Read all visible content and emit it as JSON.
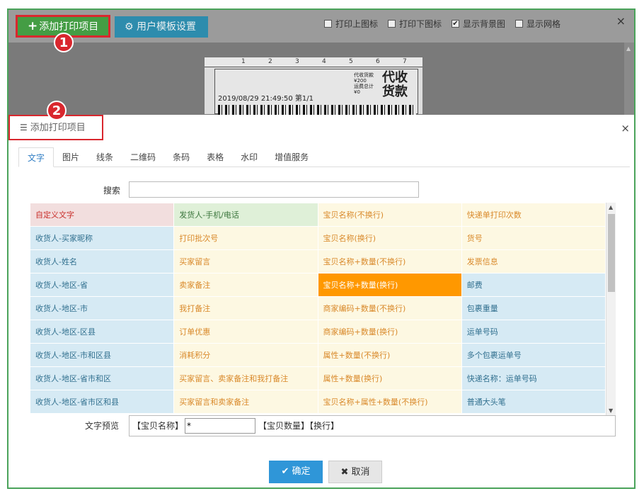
{
  "toolbar": {
    "add_button_label": "添加打印项目",
    "template_button_label": "用户模板设置",
    "checkboxes": [
      {
        "label": "打印上图标",
        "checked": false
      },
      {
        "label": "打印下图标",
        "checked": false
      },
      {
        "label": "显示背景图",
        "checked": true
      },
      {
        "label": "显示网格",
        "checked": false
      }
    ],
    "close_symbol": "×"
  },
  "label_preview": {
    "ruler_numbers": [
      "1",
      "2",
      "3",
      "4",
      "5",
      "6",
      "7"
    ],
    "datetime": "2019/08/29 21:49:50 第1/1",
    "small_lines": [
      "代收货款",
      "¥200",
      "运费总计",
      "¥0"
    ],
    "big_text_line1": "代收",
    "big_text_line2": "货款"
  },
  "badges": {
    "first": "1",
    "second": "2"
  },
  "dialog": {
    "title": "添加打印项目",
    "close_symbol": "×",
    "tabs": [
      {
        "label": "文字",
        "active": true
      },
      {
        "label": "图片",
        "active": false
      },
      {
        "label": "线条",
        "active": false
      },
      {
        "label": "二维码",
        "active": false
      },
      {
        "label": "条码",
        "active": false
      },
      {
        "label": "表格",
        "active": false
      },
      {
        "label": "水印",
        "active": false
      },
      {
        "label": "增值服务",
        "active": false
      }
    ],
    "search_label": "搜索",
    "search_value": "",
    "grid": [
      [
        "自定义文字",
        "发货人-手机/电话",
        "宝贝名称(不换行)",
        "快递单打印次数"
      ],
      [
        "收货人-买家昵称",
        "打印批次号",
        "宝贝名称(换行)",
        "货号"
      ],
      [
        "收货人-姓名",
        "买家留言",
        "宝贝名称+数量(不换行)",
        "发票信息"
      ],
      [
        "收货人-地区-省",
        "卖家备注",
        "宝贝名称+数量(换行)",
        "邮费"
      ],
      [
        "收货人-地区-市",
        "我打备注",
        "商家编码+数量(不换行)",
        "包裹重量"
      ],
      [
        "收货人-地区-区县",
        "订单优惠",
        "商家编码+数量(换行)",
        "运单号码"
      ],
      [
        "收货人-地区-市和区县",
        "消耗积分",
        "属性+数量(不换行)",
        "多个包裹运单号"
      ],
      [
        "收货人-地区-省市和区",
        "买家留言、卖家备注和我打备注",
        "属性+数量(换行)",
        "快递名称：运单号码"
      ],
      [
        "收货人-地区-省市区和县",
        "买家留言和卖家备注",
        "宝贝名称+属性+数量(不换行)",
        "普通大头笔"
      ]
    ],
    "preview_label": "文字预览",
    "preview_prefix": "【宝贝名称】",
    "preview_input_value": "*",
    "preview_suffix": "【宝贝数量】【换行】",
    "ok_label": "确定",
    "cancel_label": "取消"
  }
}
